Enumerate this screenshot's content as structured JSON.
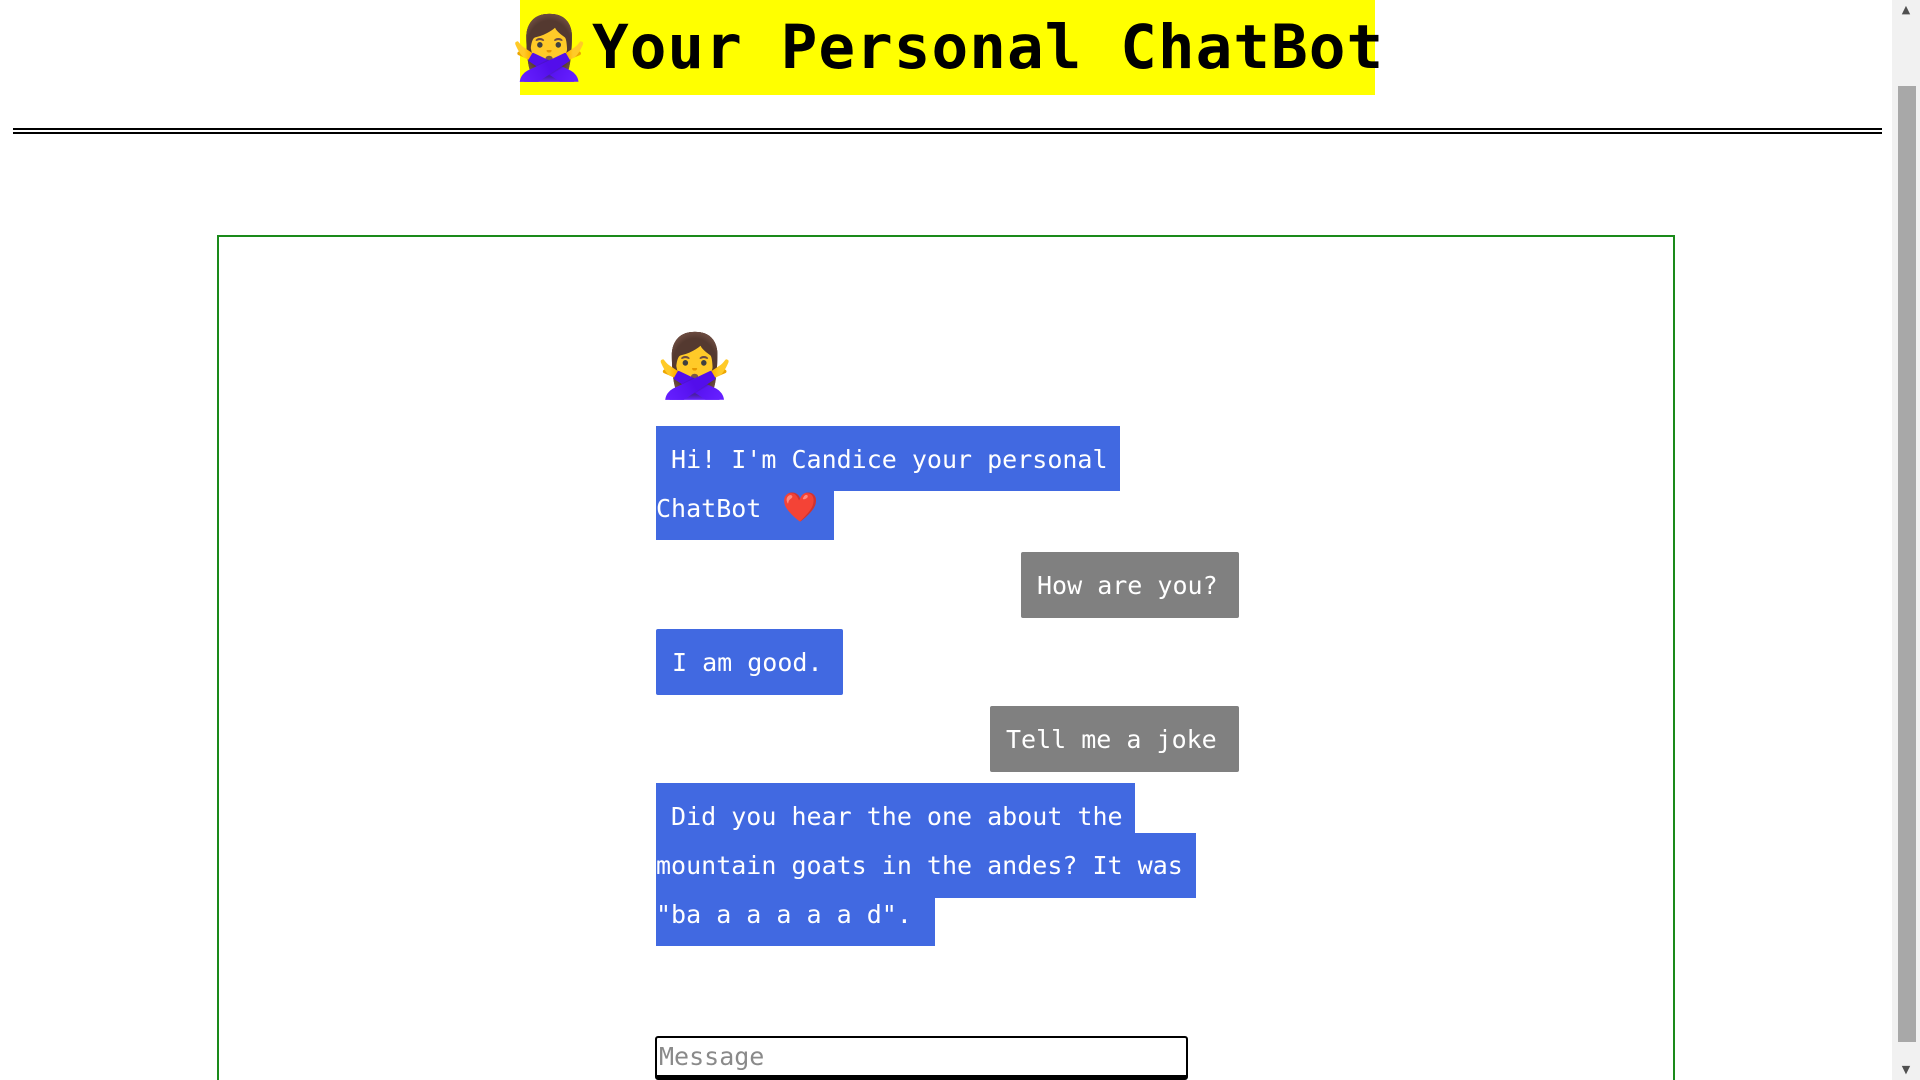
{
  "header": {
    "emoji": "🙅‍♀️",
    "title": "Your Personal ChatBot"
  },
  "chat": {
    "bot_avatar": "🙅‍♀️",
    "messages": [
      {
        "sender": "bot",
        "lines": [
          " Hi! I'm Candice your personal",
          "ChatBot "
        ],
        "trailing_icon": "❤️"
      },
      {
        "sender": "user",
        "text": "How are you?"
      },
      {
        "sender": "bot",
        "lines": [
          "I am good."
        ]
      },
      {
        "sender": "user",
        "text": "Tell me a joke"
      },
      {
        "sender": "bot",
        "lines": [
          " Did you hear the one about the",
          "mountain goats in the andes? It was",
          "\"ba a a a a a d\"."
        ]
      }
    ]
  },
  "input": {
    "placeholder": "Message",
    "value": ""
  },
  "colors": {
    "header_bg": "#ffff00",
    "bot_bubble": "#4169e1",
    "user_bubble": "#808080",
    "frame_border": "#1a8a1a"
  },
  "icons": {
    "avatar": "woman-gesturing-no-icon",
    "heart": "red-heart-icon"
  }
}
